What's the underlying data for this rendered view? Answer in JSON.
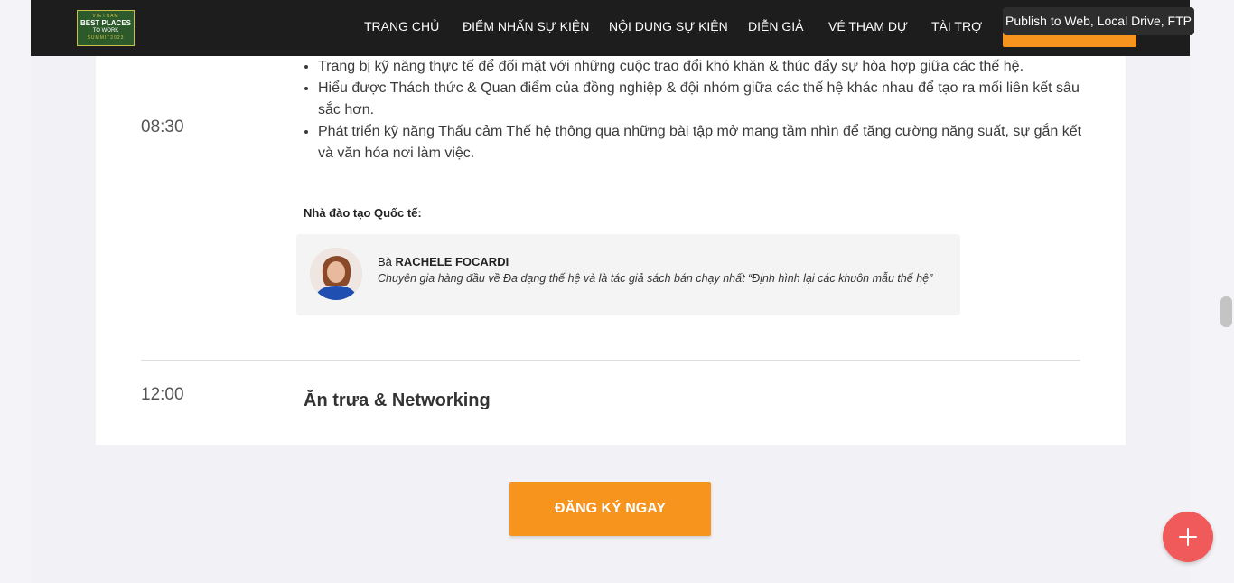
{
  "nav": {
    "logo": {
      "line1": "VIETNAM",
      "line2": "BEST PLACES",
      "line3": "TO WORK",
      "line4": "SUMMIT2023"
    },
    "items": [
      {
        "label": "TRANG CHỦ"
      },
      {
        "label": "ĐIỂM NHẤN SỰ KIỆN"
      },
      {
        "label": "NỘI DUNG SỰ KIỆN"
      },
      {
        "label": "DIỄN GIẢ"
      },
      {
        "label": "VÉ THAM DỰ"
      },
      {
        "label": "TÀI TRỢ"
      }
    ]
  },
  "tooltip": "Publish to Web, Local Drive, FTP",
  "agenda": {
    "session1": {
      "time": "08:30",
      "bullets": [
        "Trang bị kỹ năng thực tế để đối mặt với những cuộc trao đổi khó khăn & thúc đẩy sự hòa hợp giữa các thế hệ.",
        "Hiểu được Thách thức & Quan điểm của đồng nghiệp & đội nhóm giữa các thế hệ khác nhau để tạo ra mối liên kết sâu sắc hơn.",
        "Phát triển kỹ năng Thấu cảm Thế hệ thông qua những bài tập mở mang tầm nhìn để tăng cường năng suất, sự gắn kết và văn hóa nơi làm việc."
      ],
      "trainer_heading": "Nhà đào tạo Quốc tế:",
      "speaker": {
        "prefix": "Bà",
        "name": "RACHELE FOCARDI",
        "description": "Chuyên gia hàng đầu về Đa dạng thế hệ và là tác giả sách bán chạy nhất “Định hình lại các khuôn mẫu thế hệ”"
      }
    },
    "session2": {
      "time": "12:00",
      "title": "Ăn trưa & Networking"
    }
  },
  "register_button": "ĐĂNG KÝ NGAY",
  "colors": {
    "accent": "#f7941d",
    "nav_bg": "#1d1d1d",
    "fab": "#f05a5a"
  }
}
